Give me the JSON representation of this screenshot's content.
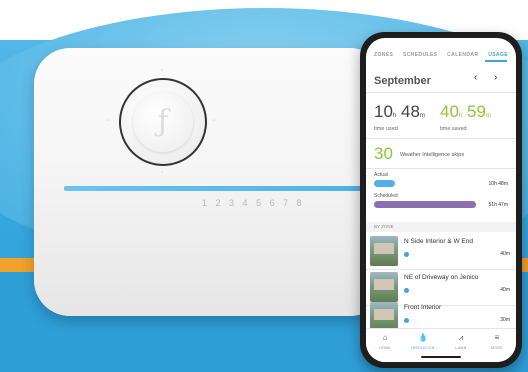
{
  "tabs": [
    {
      "label": "ZONES"
    },
    {
      "label": "SCHEDULES"
    },
    {
      "label": "CALENDAR"
    },
    {
      "label": "USAGE"
    }
  ],
  "month": "September",
  "nav": {
    "prev": "‹",
    "next": "›"
  },
  "time_used": {
    "hours": "10",
    "h_unit": "h",
    "minutes": "48",
    "m_unit": "m",
    "label": "time used"
  },
  "time_saved": {
    "hours": "40",
    "h_unit": "h",
    "minutes": "59",
    "m_unit": "m",
    "label": "time saved"
  },
  "weather_skips": {
    "count": "30",
    "label": "Weather Intelligence skips"
  },
  "actual": {
    "label": "Actual",
    "value": "10h 48m",
    "fraction": 0.21
  },
  "scheduled": {
    "label": "Scheduled",
    "value": "51h 47m",
    "fraction": 1.0
  },
  "by_zone_label": "BY ZONE",
  "zones": [
    {
      "name": "N Side Interior & W End",
      "time": "40m"
    },
    {
      "name": "NE of Driveway on Jenico",
      "time": "40m"
    },
    {
      "name": "Front Interior",
      "time": "30m"
    }
  ],
  "bottom_nav": [
    {
      "label": "HOME",
      "icon": "home-icon"
    },
    {
      "label": "IRRIGATION",
      "icon": "water-drop-icon"
    },
    {
      "label": "LAWN",
      "icon": "grass-icon"
    },
    {
      "label": "MORE",
      "icon": "menu-icon"
    }
  ],
  "controller": {
    "zone_numbers": [
      "1",
      "2",
      "3",
      "4",
      "5",
      "6",
      "7",
      "8"
    ]
  },
  "colors": {
    "accent_blue": "#3ea4d9",
    "green": "#8cc63e",
    "actual_bar": "#4fb1e8",
    "scheduled_bar": "#8b6fb0"
  }
}
